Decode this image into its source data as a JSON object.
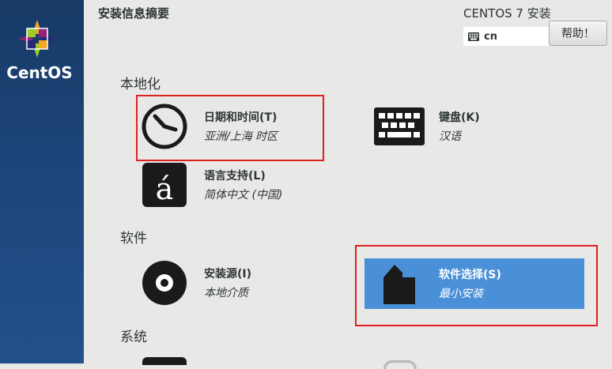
{
  "sidebar": {
    "brand": "CentOS"
  },
  "header": {
    "hub_title": "安装信息摘要",
    "product_title": "CENTOS 7 安装",
    "keyboard_layout": "cn",
    "help_label": "帮助！"
  },
  "categories": {
    "localization": "本地化",
    "software": "软件",
    "system": "系统"
  },
  "spokes": {
    "datetime": {
      "label": "日期和时间(T)",
      "status": "亚洲/上海 时区",
      "icon": "clock-icon"
    },
    "keyboard": {
      "label": "键盘(K)",
      "status": "汉语",
      "icon": "keyboard-icon"
    },
    "language": {
      "label": "语言支持(L)",
      "status": "简体中文 (中国)",
      "icon": "language-icon"
    },
    "source": {
      "label": "安装源(I)",
      "status": "本地介质",
      "icon": "disc-icon"
    },
    "software_selection": {
      "label": "软件选择(S)",
      "status": "最小安装",
      "icon": "package-icon"
    }
  },
  "colors": {
    "highlight": "#4a90d9",
    "annotation": "#e02020",
    "sidebar": "#1d4478"
  }
}
